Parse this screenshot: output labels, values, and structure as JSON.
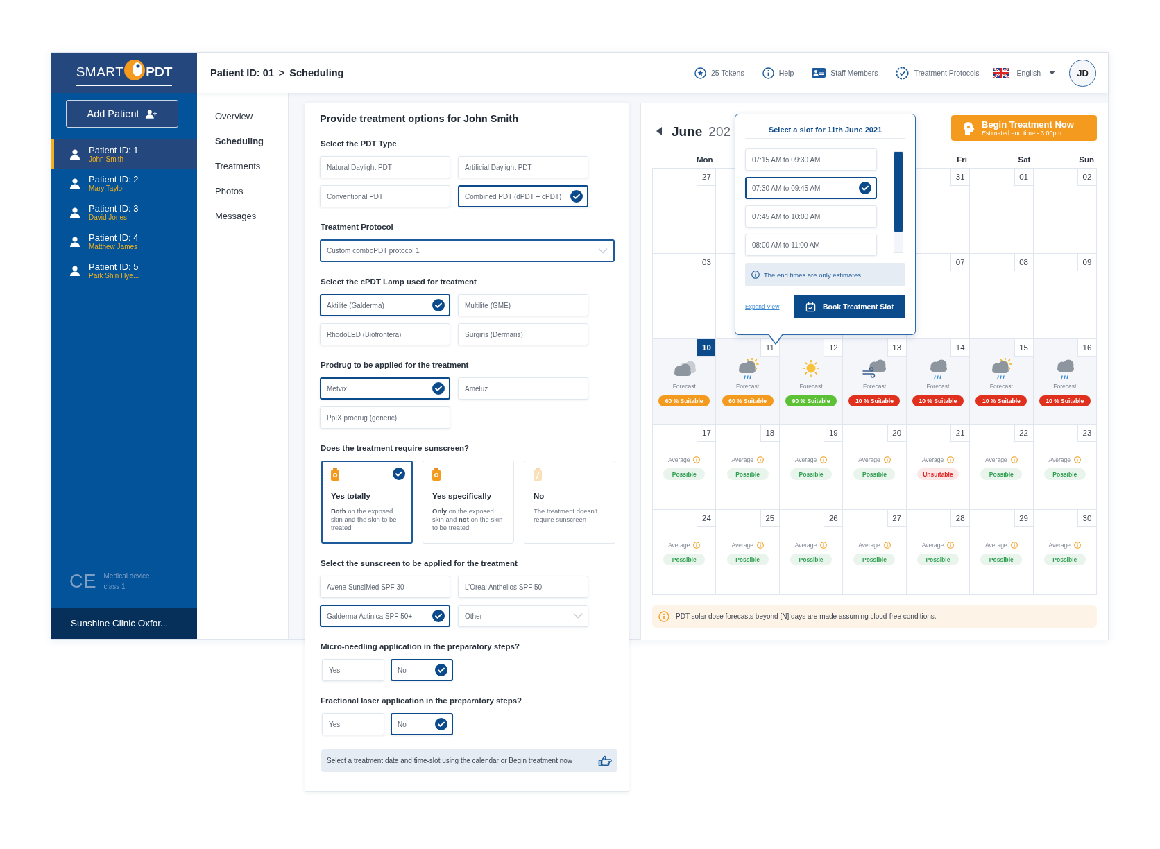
{
  "logo": {
    "left": "SMART",
    "right": "PDT"
  },
  "sidebar": {
    "add_button": "Add Patient",
    "patients": [
      {
        "id": "Patient ID: 1",
        "name": "John Smith",
        "selected": true
      },
      {
        "id": "Patient ID: 2",
        "name": "Mary Taylor",
        "selected": false
      },
      {
        "id": "Patient ID: 3",
        "name": "David Jones",
        "selected": false
      },
      {
        "id": "Patient ID: 4",
        "name": "Matthew James",
        "selected": false
      },
      {
        "id": "Patient ID: 5",
        "name": "Park Shin Hye...",
        "selected": false
      }
    ],
    "ce_mark": "CE",
    "certification": "Medical device class 1",
    "clinic": "Sunshine Clinic Oxfor..."
  },
  "header": {
    "breadcrumb": [
      "Patient ID: 01",
      "Scheduling"
    ],
    "separator": ">",
    "links": [
      {
        "kind": "tokens",
        "label": "25 Tokens"
      },
      {
        "kind": "help",
        "label": "Help"
      },
      {
        "kind": "staff",
        "label": "Staff Members"
      },
      {
        "kind": "protocols",
        "label": "Treatment Protocols"
      }
    ],
    "language": "English",
    "avatar": "JD"
  },
  "subnav": [
    {
      "label": "Overview",
      "selected": false
    },
    {
      "label": "Scheduling",
      "selected": true
    },
    {
      "label": "Treatments",
      "selected": false
    },
    {
      "label": "Photos",
      "selected": false
    },
    {
      "label": "Messages",
      "selected": false
    }
  ],
  "form": {
    "title": "Provide treatment options for John Smith",
    "sections": [
      {
        "kind": "options",
        "heading": "Select the PDT Type",
        "options": [
          {
            "label": "Natural Daylight PDT",
            "selected": false
          },
          {
            "label": "Artificial Daylight PDT",
            "selected": false
          },
          {
            "label": "Conventional PDT",
            "selected": false
          },
          {
            "label": "Combined PDT (dPDT + cPDT)",
            "selected": true
          }
        ]
      },
      {
        "kind": "select",
        "heading": "Treatment Protocol",
        "value": "Custom comboPDT protocol 1"
      },
      {
        "kind": "options",
        "heading": "Select the cPDT Lamp used for treatment",
        "options": [
          {
            "label": "Aktilite (Galderma)",
            "selected": true
          },
          {
            "label": "Multilite (GME)",
            "selected": false
          },
          {
            "label": "RhodoLED (Biofrontera)",
            "selected": false
          },
          {
            "label": "Surgiris (Dermaris)",
            "selected": false
          }
        ]
      },
      {
        "kind": "options",
        "heading": "Prodrug to be applied for the treatment",
        "options": [
          {
            "label": "Metvix",
            "selected": true
          },
          {
            "label": "Ameluz",
            "selected": false
          },
          {
            "label": "PpIX prodrug (generic)",
            "selected": false
          }
        ]
      },
      {
        "kind": "cards",
        "heading": "Does the treatment require sunscreen?",
        "cards": [
          {
            "kind": "sunscreen",
            "title": "Yes totally",
            "text": "**Both** on the exposed skin and the skin to be treated",
            "selected": true
          },
          {
            "kind": "sunscreen",
            "title": "Yes specifically",
            "text": "**Only** on the exposed skin and **not** on the skin to be treated",
            "selected": false
          },
          {
            "kind": "none",
            "title": "No",
            "text": "The treatment doesn’t require sunscreen",
            "selected": false
          }
        ]
      },
      {
        "kind": "options",
        "heading": "Select the sunscreen to be applied for the treatment",
        "options": [
          {
            "kind": "choice",
            "label": "Avene SunsiMed SPF 30",
            "selected": false
          },
          {
            "kind": "choice",
            "label": "L’Oreal Anthelios SPF 50",
            "selected": false
          },
          {
            "kind": "choice",
            "label": "Galderma Actinica SPF 50+",
            "selected": true
          },
          {
            "kind": "dropdown",
            "label": "Other",
            "selected": false
          }
        ]
      },
      {
        "kind": "yesno",
        "heading": "Micro-needling application in the preparatory steps?",
        "options": [
          {
            "label": "Yes",
            "selected": false
          },
          {
            "label": "No",
            "selected": true
          }
        ]
      },
      {
        "kind": "yesno",
        "heading": "Fractional laser application in the preparatory steps?",
        "options": [
          {
            "label": "Yes",
            "selected": false
          },
          {
            "label": "No",
            "selected": true
          }
        ]
      }
    ],
    "hint": "Select a treatment date and time-slot using the calendar or Begin treatment now"
  },
  "calendar": {
    "month": "June",
    "year": "202",
    "begin_button": {
      "title": "Begin Treatment Now",
      "subtitle": "Estimated end time - 3:00pm"
    },
    "weekdays": [
      {
        "kind": "label",
        "label": "Mon"
      },
      {
        "kind": "covered"
      },
      {
        "kind": "covered"
      },
      {
        "kind": "covered"
      },
      {
        "kind": "label",
        "label": "Fri"
      },
      {
        "kind": "label",
        "label": "Sat"
      },
      {
        "kind": "label",
        "label": "Sun"
      }
    ],
    "weeks": [
      {
        "days": [
          {
            "kind": "date",
            "day": "27",
            "selected": false
          },
          {
            "kind": "covered"
          },
          {
            "kind": "covered"
          },
          {
            "kind": "covered"
          },
          {
            "kind": "date",
            "day": "31",
            "selected": false
          },
          {
            "kind": "date",
            "day": "01",
            "selected": false
          },
          {
            "kind": "date",
            "day": "02",
            "selected": false
          }
        ]
      },
      {
        "days": [
          {
            "kind": "date",
            "day": "03",
            "selected": false
          },
          {
            "kind": "covered"
          },
          {
            "kind": "covered"
          },
          {
            "kind": "covered"
          },
          {
            "kind": "date",
            "day": "07",
            "selected": false
          },
          {
            "kind": "date",
            "day": "08",
            "selected": false
          },
          {
            "kind": "date",
            "day": "09",
            "selected": false
          }
        ]
      },
      {
        "days": [
          {
            "day": "10",
            "selected": true,
            "forecast": {
              "kind": "cloudy",
              "label": "Forecast",
              "badge": "60 % Suitable",
              "color": "#f39a1f"
            }
          },
          {
            "day": "11",
            "selected": false,
            "forecast": {
              "kind": "showers",
              "label": "Forecast",
              "badge": "60 % Suitable",
              "color": "#f39a1f"
            }
          },
          {
            "day": "12",
            "selected": false,
            "forecast": {
              "kind": "sunny",
              "label": "Forecast",
              "badge": "90 % Suitable",
              "color": "#5cc135"
            }
          },
          {
            "day": "13",
            "selected": false,
            "forecast": {
              "kind": "windy",
              "label": "Forecast",
              "badge": "10 % Suitable",
              "color": "#e0311f"
            }
          },
          {
            "day": "14",
            "selected": false,
            "forecast": {
              "kind": "rain",
              "label": "Forecast",
              "badge": "10 % Suitable",
              "color": "#e0311f"
            }
          },
          {
            "day": "15",
            "selected": false,
            "forecast": {
              "kind": "showers",
              "label": "Forecast",
              "badge": "10 % Suitable",
              "color": "#e0311f"
            }
          },
          {
            "day": "16",
            "selected": false,
            "forecast": {
              "kind": "rain",
              "label": "Forecast",
              "badge": "10 % Suitable",
              "color": "#e0311f"
            }
          }
        ]
      },
      {
        "days": [
          {
            "day": "17",
            "selected": false,
            "estimate": {
              "label": "Average",
              "status": "Possible",
              "color": "#2e9e4f"
            }
          },
          {
            "day": "18",
            "selected": false,
            "estimate": {
              "label": "Average",
              "status": "Possible",
              "color": "#2e9e4f"
            }
          },
          {
            "day": "19",
            "selected": false,
            "estimate": {
              "label": "Average",
              "status": "Possible",
              "color": "#2e9e4f"
            }
          },
          {
            "day": "20",
            "selected": false,
            "estimate": {
              "label": "Average",
              "status": "Possible",
              "color": "#2e9e4f"
            }
          },
          {
            "day": "21",
            "selected": false,
            "estimate": {
              "label": "Average",
              "status": "Unsuitable",
              "color": "#e02424"
            }
          },
          {
            "day": "22",
            "selected": false,
            "estimate": {
              "label": "Average",
              "status": "Possible",
              "color": "#2e9e4f"
            }
          },
          {
            "day": "23",
            "selected": false,
            "estimate": {
              "label": "Average",
              "status": "Possible",
              "color": "#2e9e4f"
            }
          }
        ]
      },
      {
        "days": [
          {
            "day": "24",
            "selected": false,
            "estimate": {
              "label": "Average",
              "status": "Possible",
              "color": "#2e9e4f"
            }
          },
          {
            "day": "25",
            "selected": false,
            "estimate": {
              "label": "Average",
              "status": "Possible",
              "color": "#2e9e4f"
            }
          },
          {
            "day": "26",
            "selected": false,
            "estimate": {
              "label": "Average",
              "status": "Possible",
              "color": "#2e9e4f"
            }
          },
          {
            "day": "27",
            "selected": false,
            "estimate": {
              "label": "Average",
              "status": "Possible",
              "color": "#2e9e4f"
            }
          },
          {
            "day": "28",
            "selected": false,
            "estimate": {
              "label": "Average",
              "status": "Possible",
              "color": "#2e9e4f"
            }
          },
          {
            "day": "29",
            "selected": false,
            "estimate": {
              "label": "Average",
              "status": "Possible",
              "color": "#2e9e4f"
            }
          },
          {
            "day": "30",
            "selected": false,
            "estimate": {
              "label": "Average",
              "status": "Possible",
              "color": "#2e9e4f"
            }
          }
        ]
      }
    ],
    "note": "PDT solar dose forecasts beyond [N] days are made assuming cloud-free conditions.",
    "popup": {
      "title": "Select a slot for 11th June 2021",
      "slots": [
        {
          "label": "07:15 AM to 09:30 AM",
          "selected": false
        },
        {
          "label": "07:30 AM to 09:45 AM",
          "selected": true
        },
        {
          "label": "07:45 AM to 10:00 AM",
          "selected": false
        },
        {
          "label": "08:00 AM to 11:00 AM",
          "selected": false
        }
      ],
      "note": "The end times are only estimates",
      "link": "Expand View",
      "button": "Book Treatment Slot"
    }
  }
}
